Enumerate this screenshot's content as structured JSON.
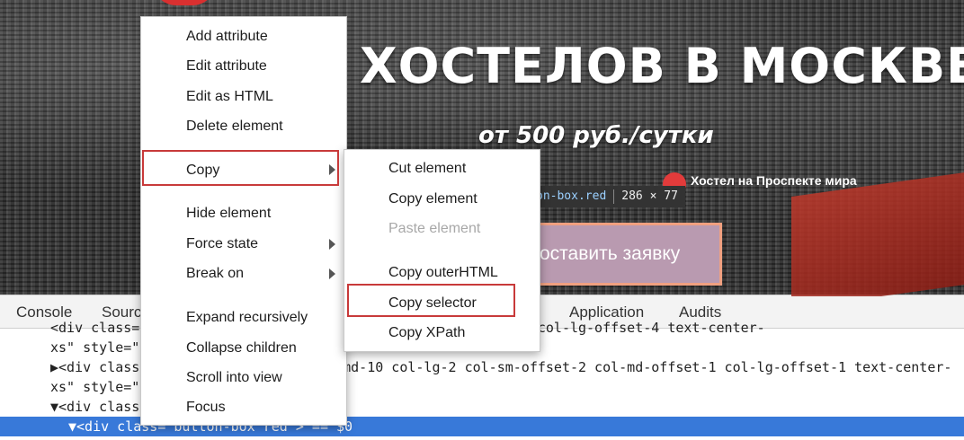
{
  "page": {
    "title": "ХОСТЕЛОВ В МОСКВЕ",
    "subtitle": "от 500 руб./сутки",
    "hostel_name": "Хостел на Проспекте мира",
    "order_button": "оставить заявку",
    "tooltip": {
      "selector": "on-box.red",
      "size": "286 × 77"
    }
  },
  "devtools": {
    "tabs": [
      "Console",
      "Sources",
      "Application",
      "Audits"
    ],
    "code_lines": [
      {
        "indent": "    ",
        "text": "<div class=\"col-xs-offset-1 col-sm-offset-2 col-md-offset-3 col-lg-offset-4 text-center-"
      },
      {
        "indent": "  ",
        "text": "xs\" style=\"margin-top: 10px\">…</div>"
      },
      {
        "indent": "  ",
        "text": "▶<div class=\"col-xs-10 col-sm-8 col-md-10 col-lg-2 col-sm-offset-2 col-md-offset-1 col-lg-offset-1 text-center-"
      },
      {
        "indent": "  ",
        "text": "xs\" style=\"margin-top: 10px\">…</div>"
      },
      {
        "indent": "  ",
        "text": "▼<div class=\"row\">"
      },
      {
        "indent": "    ",
        "text": "▼<div class=\"button-box red\"> == $0"
      }
    ]
  },
  "context_menu": {
    "items": [
      {
        "label": "Add attribute"
      },
      {
        "label": "Edit attribute"
      },
      {
        "label": "Edit as HTML"
      },
      {
        "label": "Delete element"
      },
      {
        "label": "Copy",
        "submenu": true,
        "highlighted": true
      },
      {
        "label": "Hide element"
      },
      {
        "label": "Force state",
        "submenu": true
      },
      {
        "label": "Break on",
        "submenu": true
      },
      {
        "label": "Expand recursively"
      },
      {
        "label": "Collapse children"
      },
      {
        "label": "Scroll into view"
      },
      {
        "label": "Focus"
      }
    ]
  },
  "copy_submenu": {
    "items": [
      {
        "label": "Cut element"
      },
      {
        "label": "Copy element"
      },
      {
        "label": "Paste element",
        "disabled": true
      },
      {
        "label": "Copy outerHTML"
      },
      {
        "label": "Copy selector",
        "highlighted": true
      },
      {
        "label": "Copy XPath"
      }
    ]
  },
  "colors": {
    "highlight_border": "#c83a3a",
    "selection": "#3879d9",
    "button_bg": "#b99ab0"
  }
}
